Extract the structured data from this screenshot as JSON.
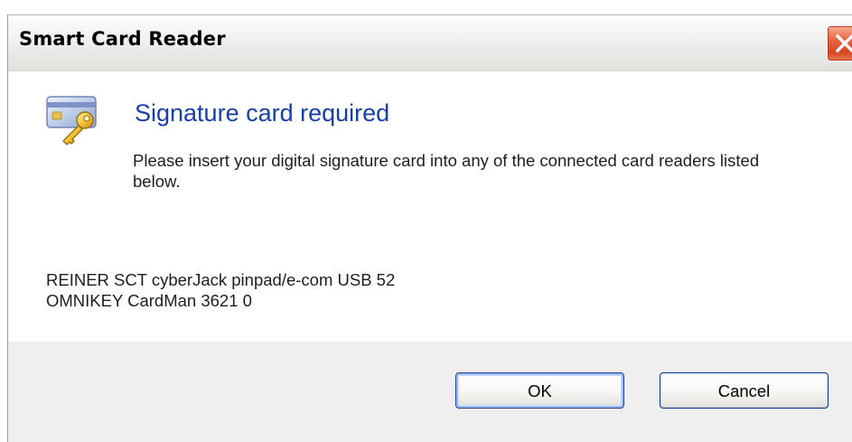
{
  "window": {
    "title": "Smart Card Reader",
    "close_icon": "close-icon"
  },
  "main": {
    "icon": "smart-card-key-icon",
    "heading": "Signature card required",
    "description": "Please insert your digital signature card into any of the connected card readers listed below.",
    "readers": [
      "REINER SCT cyberJack pinpad/e-com USB 52",
      "OMNIKEY CardMan 3621 0"
    ]
  },
  "buttons": {
    "ok_label": "OK",
    "cancel_label": "Cancel"
  },
  "colors": {
    "heading": "#1a3ea8",
    "close_button": "#d9461f",
    "footer_background": "#efefef",
    "button_border": "#1f3d91"
  }
}
